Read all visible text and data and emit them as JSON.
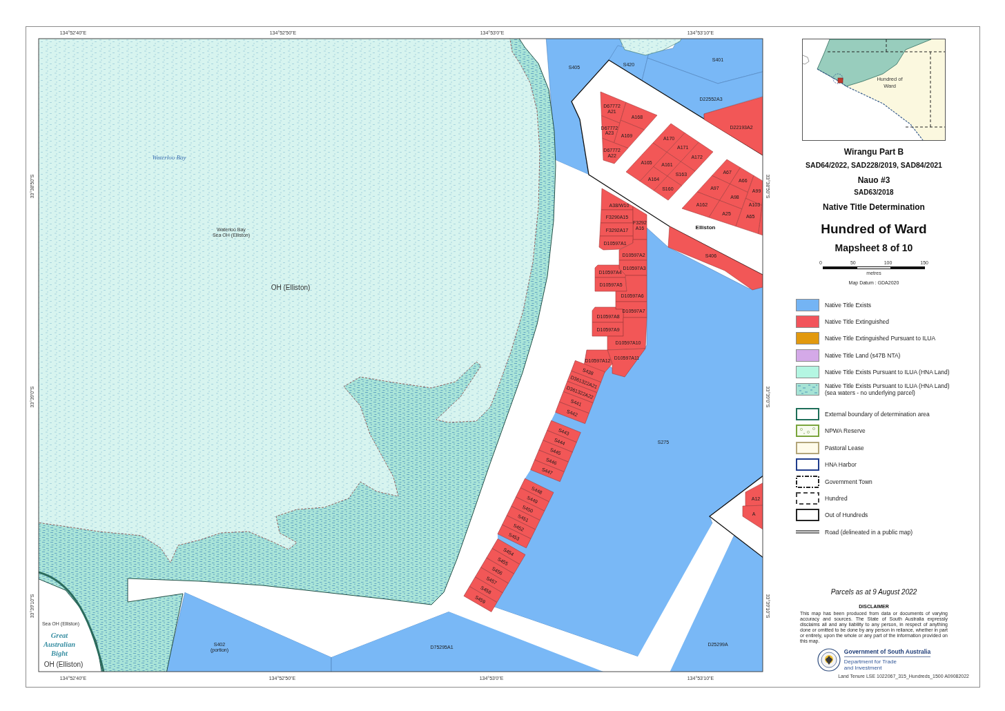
{
  "map": {
    "graticule": {
      "top": [
        "134°52'40\"E",
        "134°52'50\"E",
        "134°53'0\"E",
        "134°53'10\"E"
      ],
      "bottom": [
        "134°52'40\"E",
        "134°52'50\"E",
        "134°53'0\"E",
        "134°53'10\"E"
      ],
      "left": [
        "33°38'50\"S",
        "33°39'0\"S",
        "33°39'10\"S"
      ],
      "right": [
        "33°38'50\"S",
        "33°39'0\"S",
        "33°39'10\"S"
      ]
    },
    "place_labels": [
      {
        "lines": [
          "Waterloo Bay"
        ],
        "kind": "bay"
      },
      {
        "lines": [
          "Waterloo Bay",
          "Sea OH (Elliston)"
        ],
        "kind": "note"
      },
      {
        "lines": [
          "OH (Elliston)"
        ],
        "kind": "zone"
      },
      {
        "lines": [
          "Sea OH (Elliston)"
        ],
        "kind": "note"
      },
      {
        "lines": [
          "Great",
          "Australian",
          "Bight"
        ],
        "kind": "ocean"
      },
      {
        "lines": [
          "OH (Elliston)"
        ],
        "kind": "zone"
      },
      {
        "lines": [
          "Elliston"
        ],
        "kind": "town"
      }
    ],
    "parcels": [
      {
        "lines": [
          "S405"
        ],
        "extinguished": false
      },
      {
        "lines": [
          "S420"
        ],
        "extinguished": false
      },
      {
        "lines": [
          "S401"
        ],
        "extinguished": false
      },
      {
        "lines": [
          "D22552A3"
        ],
        "extinguished": false
      },
      {
        "lines": [
          "D67772",
          "A21"
        ],
        "extinguished": true
      },
      {
        "lines": [
          "A168"
        ],
        "extinguished": true
      },
      {
        "lines": [
          "A169"
        ],
        "extinguished": true
      },
      {
        "lines": [
          "D67772",
          "A23"
        ],
        "extinguished": true
      },
      {
        "lines": [
          "D67772",
          "A22"
        ],
        "extinguished": true
      },
      {
        "lines": [
          "D22193A2"
        ],
        "extinguished": true
      },
      {
        "lines": [
          "A170"
        ],
        "extinguished": true
      },
      {
        "lines": [
          "A171"
        ],
        "extinguished": true
      },
      {
        "lines": [
          "A172"
        ],
        "extinguished": true
      },
      {
        "lines": [
          "A165"
        ],
        "extinguished": true
      },
      {
        "lines": [
          "A161"
        ],
        "extinguished": true
      },
      {
        "lines": [
          "S163"
        ],
        "extinguished": true
      },
      {
        "lines": [
          "A164"
        ],
        "extinguished": true
      },
      {
        "lines": [
          "S160"
        ],
        "extinguished": true
      },
      {
        "lines": [
          "A67"
        ],
        "extinguished": true
      },
      {
        "lines": [
          "A66"
        ],
        "extinguished": true
      },
      {
        "lines": [
          "A97"
        ],
        "extinguished": true
      },
      {
        "lines": [
          "A99"
        ],
        "extinguished": true
      },
      {
        "lines": [
          "A98"
        ],
        "extinguished": true
      },
      {
        "lines": [
          "A162"
        ],
        "extinguished": true
      },
      {
        "lines": [
          "A103"
        ],
        "extinguished": true
      },
      {
        "lines": [
          "A25"
        ],
        "extinguished": true
      },
      {
        "lines": [
          "A65"
        ],
        "extinguished": true
      },
      {
        "lines": [
          "S406"
        ],
        "extinguished": true
      },
      {
        "lines": [
          "A38/W10"
        ],
        "extinguished": true
      },
      {
        "lines": [
          "F3290A15"
        ],
        "extinguished": true
      },
      {
        "lines": [
          "F3292",
          "A16"
        ],
        "extinguished": true
      },
      {
        "lines": [
          "F3292A17"
        ],
        "extinguished": true
      },
      {
        "lines": [
          "D10597A1"
        ],
        "extinguished": true
      },
      {
        "lines": [
          "D10597A2"
        ],
        "extinguished": true
      },
      {
        "lines": [
          "D10597A3"
        ],
        "extinguished": true
      },
      {
        "lines": [
          "D10597A4"
        ],
        "extinguished": true
      },
      {
        "lines": [
          "D10597A5"
        ],
        "extinguished": true
      },
      {
        "lines": [
          "D10597A6"
        ],
        "extinguished": true
      },
      {
        "lines": [
          "D10597A7"
        ],
        "extinguished": true
      },
      {
        "lines": [
          "D10597A8"
        ],
        "extinguished": true
      },
      {
        "lines": [
          "D10597A9"
        ],
        "extinguished": true
      },
      {
        "lines": [
          "D10597A10"
        ],
        "extinguished": true
      },
      {
        "lines": [
          "D10597A11"
        ],
        "extinguished": true
      },
      {
        "lines": [
          "D10597A12"
        ],
        "extinguished": true
      },
      {
        "lines": [
          "S438"
        ],
        "extinguished": true
      },
      {
        "lines": [
          "D361322A21"
        ],
        "extinguished": true
      },
      {
        "lines": [
          "D361322A22"
        ],
        "extinguished": true
      },
      {
        "lines": [
          "S441"
        ],
        "extinguished": true
      },
      {
        "lines": [
          "S442"
        ],
        "extinguished": true
      },
      {
        "lines": [
          "S443"
        ],
        "extinguished": true
      },
      {
        "lines": [
          "S444"
        ],
        "extinguished": true
      },
      {
        "lines": [
          "S445"
        ],
        "extinguished": true
      },
      {
        "lines": [
          "S446"
        ],
        "extinguished": true
      },
      {
        "lines": [
          "S447"
        ],
        "extinguished": true
      },
      {
        "lines": [
          "S448"
        ],
        "extinguished": true
      },
      {
        "lines": [
          "S449"
        ],
        "extinguished": true
      },
      {
        "lines": [
          "S450"
        ],
        "extinguished": true
      },
      {
        "lines": [
          "S451"
        ],
        "extinguished": true
      },
      {
        "lines": [
          "S452"
        ],
        "extinguished": true
      },
      {
        "lines": [
          "S453"
        ],
        "extinguished": true
      },
      {
        "lines": [
          "S454"
        ],
        "extinguished": true
      },
      {
        "lines": [
          "S455"
        ],
        "extinguished": true
      },
      {
        "lines": [
          "S456"
        ],
        "extinguished": true
      },
      {
        "lines": [
          "S457"
        ],
        "extinguished": true
      },
      {
        "lines": [
          "S458"
        ],
        "extinguished": true
      },
      {
        "lines": [
          "S459"
        ],
        "extinguished": true
      },
      {
        "lines": [
          "S275"
        ],
        "extinguished": false
      },
      {
        "lines": [
          "A12"
        ],
        "extinguished": true
      },
      {
        "lines": [
          "A"
        ],
        "extinguished": true
      },
      {
        "lines": [
          "S402",
          "(portion)"
        ],
        "extinguished": false
      },
      {
        "lines": [
          "D75295A1"
        ],
        "extinguished": false
      },
      {
        "lines": [
          "D25299A"
        ],
        "extinguished": false
      }
    ]
  },
  "inset": {
    "label": [
      "Hundred of",
      "Ward"
    ]
  },
  "title_block": [
    {
      "text": "Wirangu Part B",
      "kind": "claim"
    },
    {
      "text": "SAD64/2022, SAD228/2019, SAD84/2021",
      "kind": "case"
    },
    {
      "text": "Nauo #3",
      "kind": "claim"
    },
    {
      "text": "SAD63/2018",
      "kind": "case-small"
    },
    {
      "text": "Native Title Determination",
      "kind": "claim"
    },
    {
      "text": "Hundred of Ward",
      "kind": "sheet-title"
    },
    {
      "text": "Mapsheet 8 of 10",
      "kind": "sheet-number"
    }
  ],
  "scale_bar": {
    "ticks": [
      "0",
      "50",
      "100",
      "150"
    ],
    "unit": "metres"
  },
  "datum": "Map Datum : GDA2020",
  "legend": {
    "items": [
      {
        "label": "Native Title Exists",
        "kind": "fill",
        "color": "#74b4f4"
      },
      {
        "label": "Native Title Extinguished",
        "kind": "fill",
        "color": "#f2545b"
      },
      {
        "label": "Native Title Extinguished Pursuant to ILUA",
        "kind": "fill",
        "color": "#e2990e"
      },
      {
        "label": "Native Title Land (s47B NTA)",
        "kind": "fill",
        "color": "#d4a9e8"
      },
      {
        "label": "Native Title Exists Pursuant to ILUA (HNA Land)",
        "kind": "fill",
        "color": "#b4f6e2"
      },
      {
        "label": "Native Title Exists Pursuant to ILUA (HNA Land)",
        "note": "(sea waters - no underlying parcel)",
        "kind": "sea-pattern",
        "color": "#a6e3d5"
      },
      {
        "label": "External boundary of determination area",
        "kind": "outline",
        "color": "#1e6e58"
      },
      {
        "label": "NPWA Reserve",
        "kind": "reserve-pattern",
        "color": "#7aa53c"
      },
      {
        "label": "Pastoral Lease",
        "kind": "lease",
        "color": "#b3a57a"
      },
      {
        "label": "HNA Harbor",
        "kind": "outline",
        "color": "#1f3c8c"
      },
      {
        "label": "Government Town",
        "kind": "dash-dot",
        "color": "#222222"
      },
      {
        "label": "Hundred",
        "kind": "dashed",
        "color": "#444444"
      },
      {
        "label": "Out of Hundreds",
        "kind": "outline",
        "color": "#222222"
      },
      {
        "label": "Road (delineated in a public map)",
        "kind": "road",
        "color": "#777777"
      }
    ]
  },
  "parcels_date": "Parcels as at 9 August 2022",
  "disclaimer": {
    "title": "DISCLAIMER",
    "text": "This map has been produced from data or documents of varying accuracy and sources. The State of South Australia expressly disclaims all and any liability to any person, in respect of anything done or omitted to be done by any person in reliance, whether in part or entirely, upon the whole or any part of the information provided on this map."
  },
  "agency": {
    "government": "Government of South Australia",
    "department": [
      "Department for Trade",
      "and Investment"
    ]
  },
  "file_reference": "Land Tenure LSE 1022067_315_Hundreds_1500 A09082022"
}
